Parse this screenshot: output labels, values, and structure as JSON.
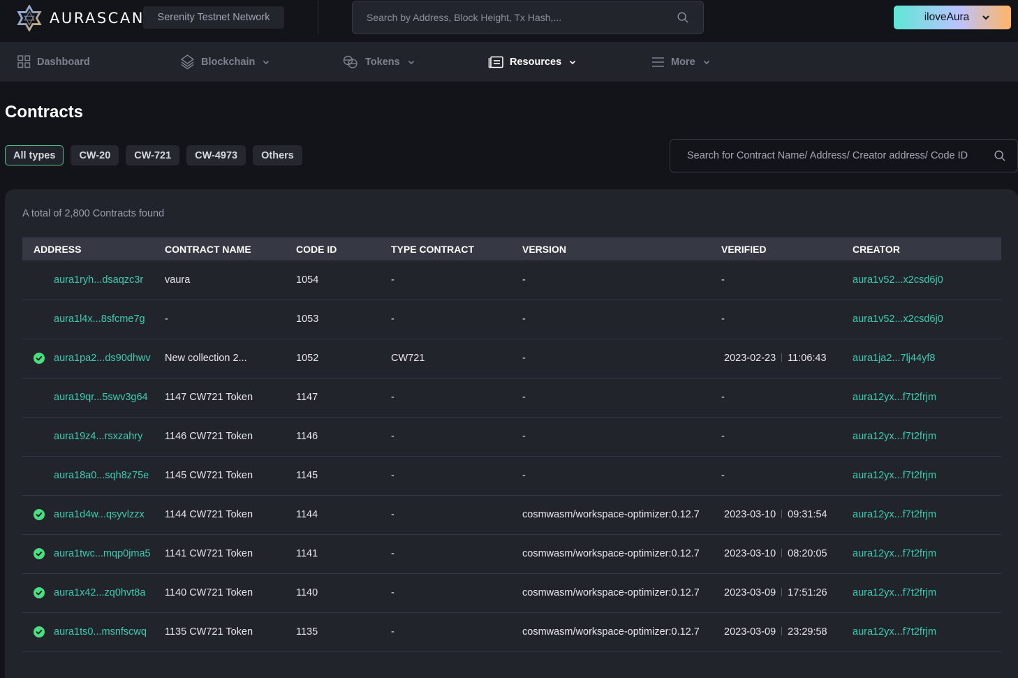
{
  "header": {
    "brand": "AURASCAN",
    "network": "Serenity Testnet Network",
    "search_placeholder": "Search by Address, Block Height, Tx Hash,...",
    "wallet_label": "iloveAura"
  },
  "nav": {
    "items": [
      {
        "label": "Dashboard",
        "icon": "grid-icon",
        "has_dropdown": false,
        "active": false
      },
      {
        "label": "Blockchain",
        "icon": "layers-icon",
        "has_dropdown": true,
        "active": false
      },
      {
        "label": "Tokens",
        "icon": "coins-icon",
        "has_dropdown": true,
        "active": false
      },
      {
        "label": "Resources",
        "icon": "document-list-icon",
        "has_dropdown": true,
        "active": true
      },
      {
        "label": "More",
        "icon": "menu-icon",
        "has_dropdown": true,
        "active": false
      }
    ]
  },
  "page": {
    "title": "Contracts",
    "filters": [
      {
        "label": "All types",
        "active": true
      },
      {
        "label": "CW-20",
        "active": false
      },
      {
        "label": "CW-721",
        "active": false
      },
      {
        "label": "CW-4973",
        "active": false
      },
      {
        "label": "Others",
        "active": false
      }
    ],
    "search_placeholder": "Search for Contract Name/ Address/ Creator address/ Code ID",
    "total_text": "A total of 2,800 Contracts found"
  },
  "colors": {
    "accent_link": "#3ecbb0",
    "verified_green": "#4ade80",
    "active_filter_border": "#4fbf8c"
  },
  "table": {
    "columns": [
      "ADDRESS",
      "CONTRACT NAME",
      "CODE ID",
      "TYPE CONTRACT",
      "VERSION",
      "VERIFIED",
      "CREATOR"
    ],
    "rows": [
      {
        "verified": false,
        "address": "aura1ryh...dsaqzc3r",
        "name": "vaura",
        "code_id": "1054",
        "type": "-",
        "version": "-",
        "verified_date": "-",
        "verified_time": "",
        "creator": "aura1v52...x2csd6j0"
      },
      {
        "verified": false,
        "address": "aura1l4x...8sfcme7g",
        "name": "-",
        "code_id": "1053",
        "type": "-",
        "version": "-",
        "verified_date": "-",
        "verified_time": "",
        "creator": "aura1v52...x2csd6j0"
      },
      {
        "verified": true,
        "address": "aura1pa2...ds90dhwv",
        "name": "New collection 2...",
        "code_id": "1052",
        "type": "CW721",
        "version": "-",
        "verified_date": "2023-02-23",
        "verified_time": "11:06:43",
        "creator": "aura1ja2...7lj44yf8"
      },
      {
        "verified": false,
        "address": "aura19qr...5swv3g64",
        "name": "1147 CW721 Token",
        "code_id": "1147",
        "type": "-",
        "version": "-",
        "verified_date": "-",
        "verified_time": "",
        "creator": "aura12yx...f7t2frjm"
      },
      {
        "verified": false,
        "address": "aura19z4...rsxzahry",
        "name": "1146 CW721 Token",
        "code_id": "1146",
        "type": "-",
        "version": "-",
        "verified_date": "-",
        "verified_time": "",
        "creator": "aura12yx...f7t2frjm"
      },
      {
        "verified": false,
        "address": "aura18a0...sqh8z75e",
        "name": "1145 CW721 Token",
        "code_id": "1145",
        "type": "-",
        "version": "-",
        "verified_date": "-",
        "verified_time": "",
        "creator": "aura12yx...f7t2frjm"
      },
      {
        "verified": true,
        "address": "aura1d4w...qsyvlzzx",
        "name": "1144 CW721 Token",
        "code_id": "1144",
        "type": "-",
        "version": "cosmwasm/workspace-optimizer:0.12.7",
        "verified_date": "2023-03-10",
        "verified_time": "09:31:54",
        "creator": "aura12yx...f7t2frjm"
      },
      {
        "verified": true,
        "address": "aura1twc...mqp0jma5",
        "name": "1141 CW721 Token",
        "code_id": "1141",
        "type": "-",
        "version": "cosmwasm/workspace-optimizer:0.12.7",
        "verified_date": "2023-03-10",
        "verified_time": "08:20:05",
        "creator": "aura12yx...f7t2frjm"
      },
      {
        "verified": true,
        "address": "aura1x42...zq0hvt8a",
        "name": "1140 CW721 Token",
        "code_id": "1140",
        "type": "-",
        "version": "cosmwasm/workspace-optimizer:0.12.7",
        "verified_date": "2023-03-09",
        "verified_time": "17:51:26",
        "creator": "aura12yx...f7t2frjm"
      },
      {
        "verified": true,
        "address": "aura1ts0...msnfscwq",
        "name": "1135 CW721 Token",
        "code_id": "1135",
        "type": "-",
        "version": "cosmwasm/workspace-optimizer:0.12.7",
        "verified_date": "2023-03-09",
        "verified_time": "23:29:58",
        "creator": "aura12yx...f7t2frjm"
      }
    ]
  }
}
